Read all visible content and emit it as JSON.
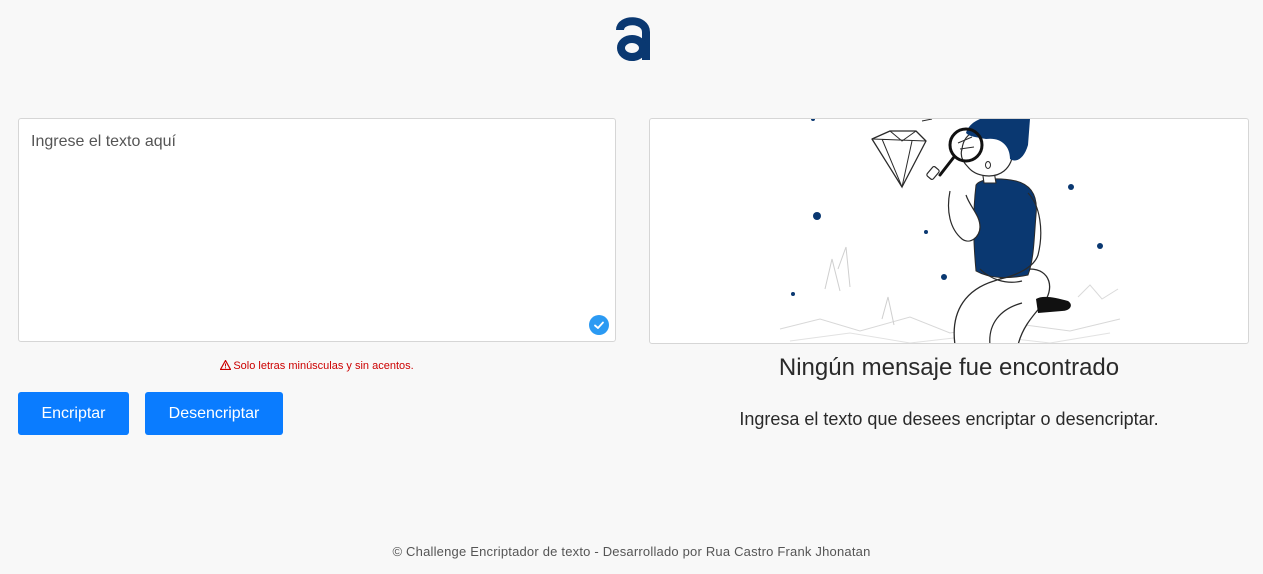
{
  "logo": {
    "icon": "alura-logo-icon",
    "color": "#0a3871"
  },
  "input": {
    "placeholder": "Ingrese el texto aquí",
    "value": "",
    "status_icon": "checkmark-icon",
    "status_color": "#2b9af3"
  },
  "warning": {
    "icon": "warning-triangle-icon",
    "text": "Solo letras minúsculas y sin acentos.",
    "color": "#cc0000"
  },
  "buttons": {
    "encrypt_label": "Encriptar",
    "decrypt_label": "Desencriptar",
    "color": "#0a7cff"
  },
  "output": {
    "illustration": "person-with-magnifying-glass-illustration",
    "title": "Ningún mensaje fue encontrado",
    "subtitle": "Ingresa el texto que desees encriptar o desencriptar."
  },
  "footer": {
    "text": "© Challenge Encriptador de texto - Desarrollado por Rua Castro Frank Jhonatan"
  },
  "colors": {
    "background": "#f8f8f8",
    "accent_dark": "#0a3871",
    "button_blue": "#0a7cff"
  }
}
